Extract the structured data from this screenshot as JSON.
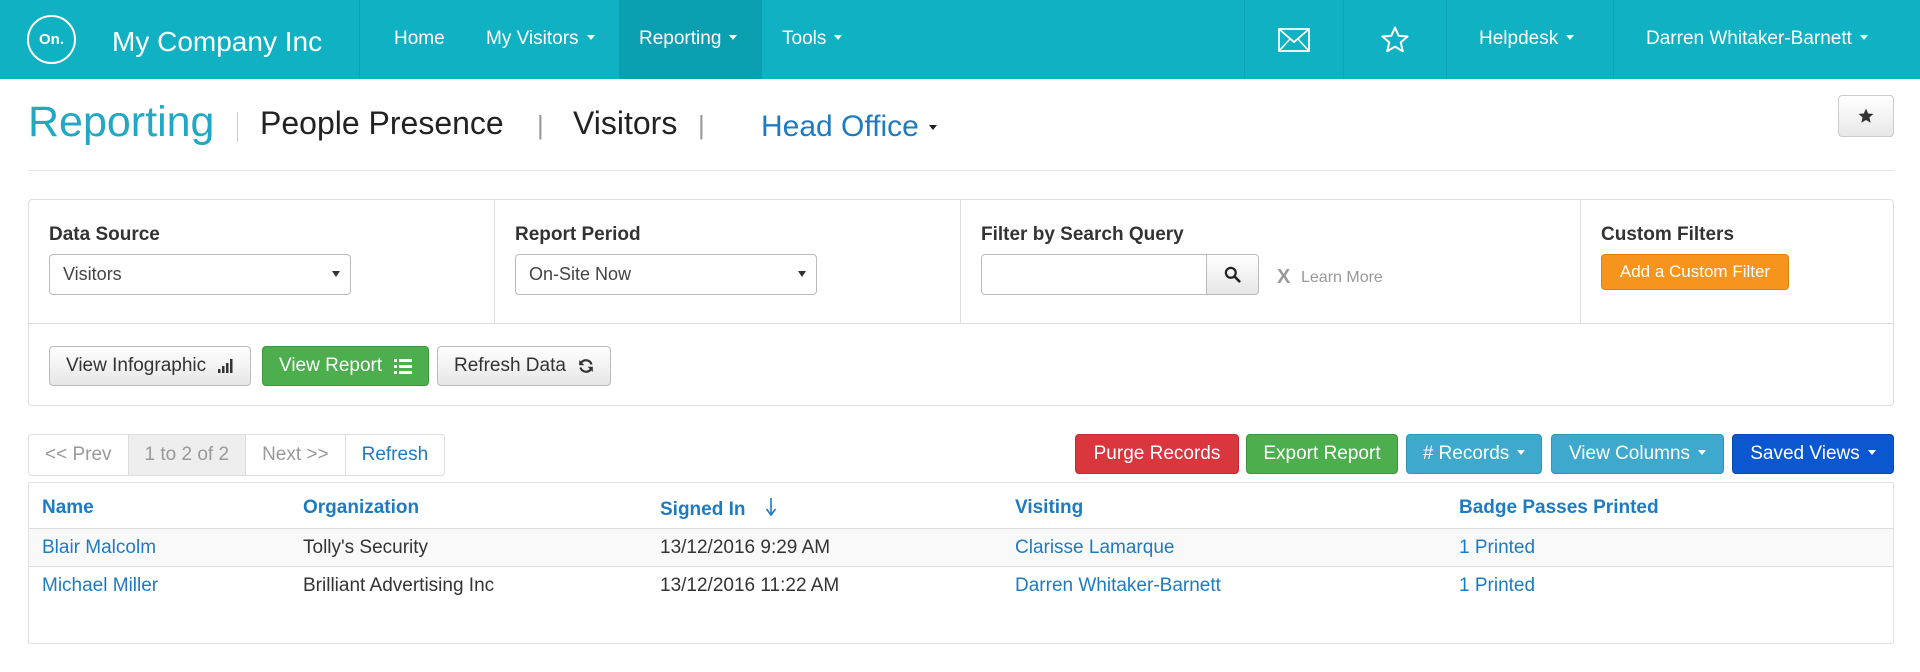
{
  "navbar": {
    "logo_text": "On.",
    "company": "My Company Inc",
    "items": [
      {
        "label": "Home"
      },
      {
        "label": "My Visitors"
      },
      {
        "label": "Reporting"
      },
      {
        "label": "Tools"
      }
    ],
    "helpdesk": "Helpdesk",
    "user": "Darren Whitaker-Barnett",
    "icons": [
      "envelope-icon",
      "star-icon"
    ],
    "colors": {
      "bar": "#0fb1c2",
      "active": "#0aa0b1"
    }
  },
  "header": {
    "title": "Reporting",
    "crumbs": [
      "People Presence",
      "Visitors"
    ],
    "separator": "|",
    "location": "Head Office"
  },
  "filters": {
    "data_source": {
      "label": "Data Source",
      "value": "Visitors"
    },
    "report_period": {
      "label": "Report Period",
      "value": "On-Site Now"
    },
    "search": {
      "label": "Filter by Search Query",
      "value": "",
      "placeholder": "",
      "clear": "X",
      "learn_more": "Learn More"
    },
    "custom": {
      "label": "Custom Filters",
      "button": "Add a Custom Filter"
    }
  },
  "actions": {
    "infographic": "View Infographic",
    "report": "View Report",
    "refresh": "Refresh Data"
  },
  "pager": {
    "prev": "<< Prev",
    "range": "1 to 2 of 2",
    "next": "Next >>",
    "refresh": "Refresh"
  },
  "toolbar": {
    "purge": "Purge Records",
    "export": "Export Report",
    "records": "# Records",
    "columns": "View Columns",
    "saved": "Saved Views",
    "colors": {
      "purge": "#d9363e",
      "export": "#4cae4c",
      "records": "#3ea9cc",
      "columns": "#3ea9cc",
      "saved": "#0b57d0"
    }
  },
  "table": {
    "headers": [
      "Name",
      "Organization",
      "Signed In",
      "Visiting",
      "Badge Passes Printed"
    ],
    "rows": [
      [
        "Blair Malcolm",
        "Tolly's Security",
        "13/12/2016 9:29 AM",
        "Clarisse Lamarque",
        "1 Printed"
      ],
      [
        "Michael Miller",
        "Brilliant Advertising Inc",
        "13/12/2016 11:22 AM",
        "Darren Whitaker-Barnett",
        "1 Printed"
      ]
    ]
  }
}
